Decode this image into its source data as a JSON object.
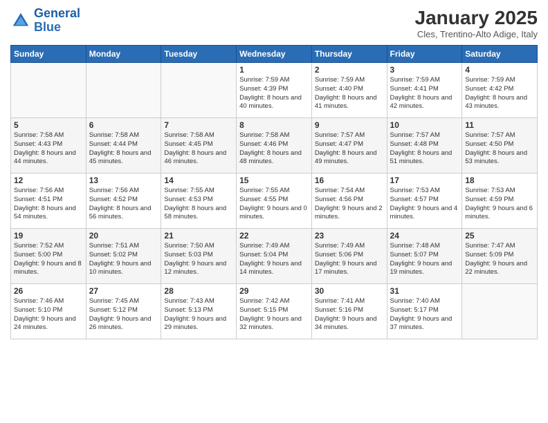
{
  "logo": {
    "line1": "General",
    "line2": "Blue"
  },
  "title": "January 2025",
  "subtitle": "Cles, Trentino-Alto Adige, Italy",
  "headers": [
    "Sunday",
    "Monday",
    "Tuesday",
    "Wednesday",
    "Thursday",
    "Friday",
    "Saturday"
  ],
  "weeks": [
    [
      {
        "day": "",
        "sunrise": "",
        "sunset": "",
        "daylight": ""
      },
      {
        "day": "",
        "sunrise": "",
        "sunset": "",
        "daylight": ""
      },
      {
        "day": "",
        "sunrise": "",
        "sunset": "",
        "daylight": ""
      },
      {
        "day": "1",
        "sunrise": "Sunrise: 7:59 AM",
        "sunset": "Sunset: 4:39 PM",
        "daylight": "Daylight: 8 hours and 40 minutes."
      },
      {
        "day": "2",
        "sunrise": "Sunrise: 7:59 AM",
        "sunset": "Sunset: 4:40 PM",
        "daylight": "Daylight: 8 hours and 41 minutes."
      },
      {
        "day": "3",
        "sunrise": "Sunrise: 7:59 AM",
        "sunset": "Sunset: 4:41 PM",
        "daylight": "Daylight: 8 hours and 42 minutes."
      },
      {
        "day": "4",
        "sunrise": "Sunrise: 7:59 AM",
        "sunset": "Sunset: 4:42 PM",
        "daylight": "Daylight: 8 hours and 43 minutes."
      }
    ],
    [
      {
        "day": "5",
        "sunrise": "Sunrise: 7:58 AM",
        "sunset": "Sunset: 4:43 PM",
        "daylight": "Daylight: 8 hours and 44 minutes."
      },
      {
        "day": "6",
        "sunrise": "Sunrise: 7:58 AM",
        "sunset": "Sunset: 4:44 PM",
        "daylight": "Daylight: 8 hours and 45 minutes."
      },
      {
        "day": "7",
        "sunrise": "Sunrise: 7:58 AM",
        "sunset": "Sunset: 4:45 PM",
        "daylight": "Daylight: 8 hours and 46 minutes."
      },
      {
        "day": "8",
        "sunrise": "Sunrise: 7:58 AM",
        "sunset": "Sunset: 4:46 PM",
        "daylight": "Daylight: 8 hours and 48 minutes."
      },
      {
        "day": "9",
        "sunrise": "Sunrise: 7:57 AM",
        "sunset": "Sunset: 4:47 PM",
        "daylight": "Daylight: 8 hours and 49 minutes."
      },
      {
        "day": "10",
        "sunrise": "Sunrise: 7:57 AM",
        "sunset": "Sunset: 4:48 PM",
        "daylight": "Daylight: 8 hours and 51 minutes."
      },
      {
        "day": "11",
        "sunrise": "Sunrise: 7:57 AM",
        "sunset": "Sunset: 4:50 PM",
        "daylight": "Daylight: 8 hours and 53 minutes."
      }
    ],
    [
      {
        "day": "12",
        "sunrise": "Sunrise: 7:56 AM",
        "sunset": "Sunset: 4:51 PM",
        "daylight": "Daylight: 8 hours and 54 minutes."
      },
      {
        "day": "13",
        "sunrise": "Sunrise: 7:56 AM",
        "sunset": "Sunset: 4:52 PM",
        "daylight": "Daylight: 8 hours and 56 minutes."
      },
      {
        "day": "14",
        "sunrise": "Sunrise: 7:55 AM",
        "sunset": "Sunset: 4:53 PM",
        "daylight": "Daylight: 8 hours and 58 minutes."
      },
      {
        "day": "15",
        "sunrise": "Sunrise: 7:55 AM",
        "sunset": "Sunset: 4:55 PM",
        "daylight": "Daylight: 9 hours and 0 minutes."
      },
      {
        "day": "16",
        "sunrise": "Sunrise: 7:54 AM",
        "sunset": "Sunset: 4:56 PM",
        "daylight": "Daylight: 9 hours and 2 minutes."
      },
      {
        "day": "17",
        "sunrise": "Sunrise: 7:53 AM",
        "sunset": "Sunset: 4:57 PM",
        "daylight": "Daylight: 9 hours and 4 minutes."
      },
      {
        "day": "18",
        "sunrise": "Sunrise: 7:53 AM",
        "sunset": "Sunset: 4:59 PM",
        "daylight": "Daylight: 9 hours and 6 minutes."
      }
    ],
    [
      {
        "day": "19",
        "sunrise": "Sunrise: 7:52 AM",
        "sunset": "Sunset: 5:00 PM",
        "daylight": "Daylight: 9 hours and 8 minutes."
      },
      {
        "day": "20",
        "sunrise": "Sunrise: 7:51 AM",
        "sunset": "Sunset: 5:02 PM",
        "daylight": "Daylight: 9 hours and 10 minutes."
      },
      {
        "day": "21",
        "sunrise": "Sunrise: 7:50 AM",
        "sunset": "Sunset: 5:03 PM",
        "daylight": "Daylight: 9 hours and 12 minutes."
      },
      {
        "day": "22",
        "sunrise": "Sunrise: 7:49 AM",
        "sunset": "Sunset: 5:04 PM",
        "daylight": "Daylight: 9 hours and 14 minutes."
      },
      {
        "day": "23",
        "sunrise": "Sunrise: 7:49 AM",
        "sunset": "Sunset: 5:06 PM",
        "daylight": "Daylight: 9 hours and 17 minutes."
      },
      {
        "day": "24",
        "sunrise": "Sunrise: 7:48 AM",
        "sunset": "Sunset: 5:07 PM",
        "daylight": "Daylight: 9 hours and 19 minutes."
      },
      {
        "day": "25",
        "sunrise": "Sunrise: 7:47 AM",
        "sunset": "Sunset: 5:09 PM",
        "daylight": "Daylight: 9 hours and 22 minutes."
      }
    ],
    [
      {
        "day": "26",
        "sunrise": "Sunrise: 7:46 AM",
        "sunset": "Sunset: 5:10 PM",
        "daylight": "Daylight: 9 hours and 24 minutes."
      },
      {
        "day": "27",
        "sunrise": "Sunrise: 7:45 AM",
        "sunset": "Sunset: 5:12 PM",
        "daylight": "Daylight: 9 hours and 26 minutes."
      },
      {
        "day": "28",
        "sunrise": "Sunrise: 7:43 AM",
        "sunset": "Sunset: 5:13 PM",
        "daylight": "Daylight: 9 hours and 29 minutes."
      },
      {
        "day": "29",
        "sunrise": "Sunrise: 7:42 AM",
        "sunset": "Sunset: 5:15 PM",
        "daylight": "Daylight: 9 hours and 32 minutes."
      },
      {
        "day": "30",
        "sunrise": "Sunrise: 7:41 AM",
        "sunset": "Sunset: 5:16 PM",
        "daylight": "Daylight: 9 hours and 34 minutes."
      },
      {
        "day": "31",
        "sunrise": "Sunrise: 7:40 AM",
        "sunset": "Sunset: 5:17 PM",
        "daylight": "Daylight: 9 hours and 37 minutes."
      },
      {
        "day": "",
        "sunrise": "",
        "sunset": "",
        "daylight": ""
      }
    ]
  ]
}
